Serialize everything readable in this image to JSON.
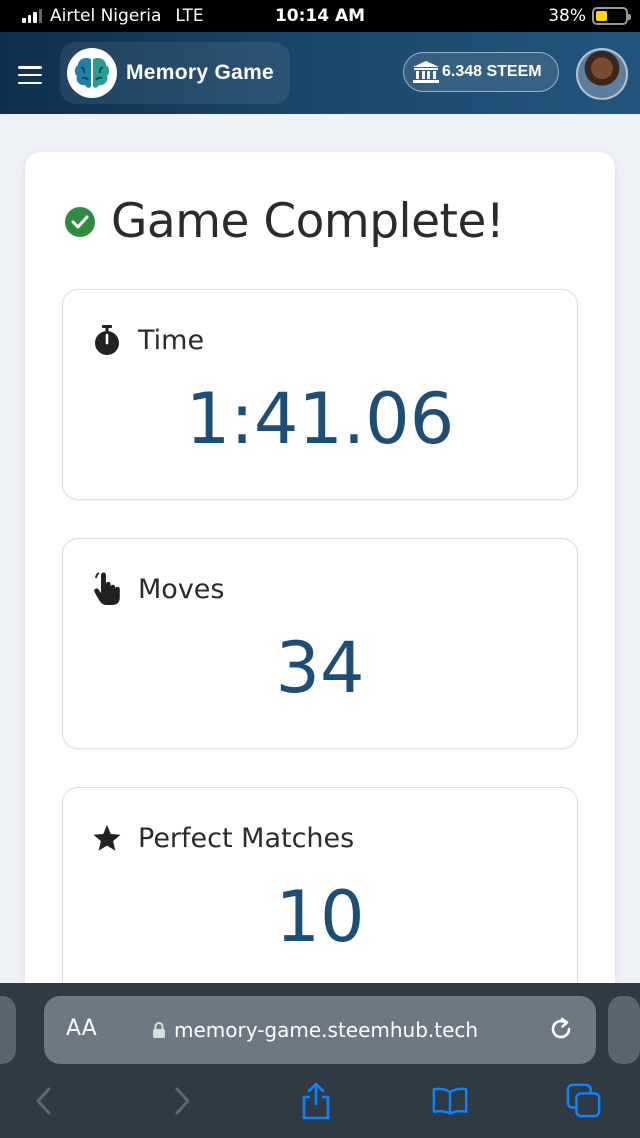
{
  "status_bar": {
    "carrier": "Airtel Nigeria",
    "network": "LTE",
    "time": "10:14 AM",
    "battery": "38%"
  },
  "header": {
    "app_title": "Memory Game",
    "balance": "6.348 STEEM"
  },
  "result": {
    "heading": "Game Complete!",
    "stats": [
      {
        "label": "Time",
        "value": "1:41.06",
        "icon": "stopwatch-icon"
      },
      {
        "label": "Moves",
        "value": "34",
        "icon": "pointer-hand-icon"
      },
      {
        "label": "Perfect Matches",
        "value": "10",
        "icon": "star-icon"
      }
    ]
  },
  "browser": {
    "aa_label": "AA",
    "url": "memory-game.steemhub.tech"
  },
  "colors": {
    "header_bg": "#1b4a70",
    "value_text": "#1e4d75",
    "success_green": "#2e8b3f",
    "ios_link_blue": "#0a84ff"
  }
}
